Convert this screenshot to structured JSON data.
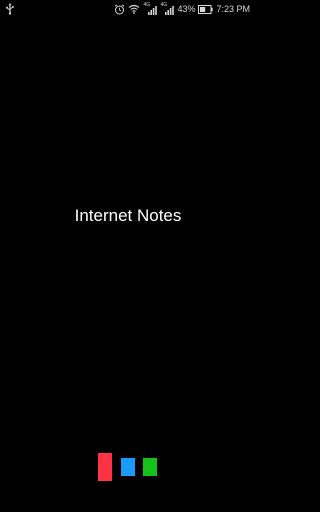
{
  "status_bar": {
    "left_icon": "usb-icon",
    "icons": [
      "alarm-icon",
      "wifi-icon",
      "signal-4g-icon",
      "signal-icon",
      "battery-icon"
    ],
    "signal_tag_1": "4G",
    "signal_tag_2": "4G",
    "battery": "43%",
    "time": "7:23 PM"
  },
  "splash": {
    "title": "Internet Notes"
  },
  "loader": {
    "colors": {
      "red": "#ff3344",
      "blue": "#1a9cff",
      "green": "#15c21a"
    }
  }
}
